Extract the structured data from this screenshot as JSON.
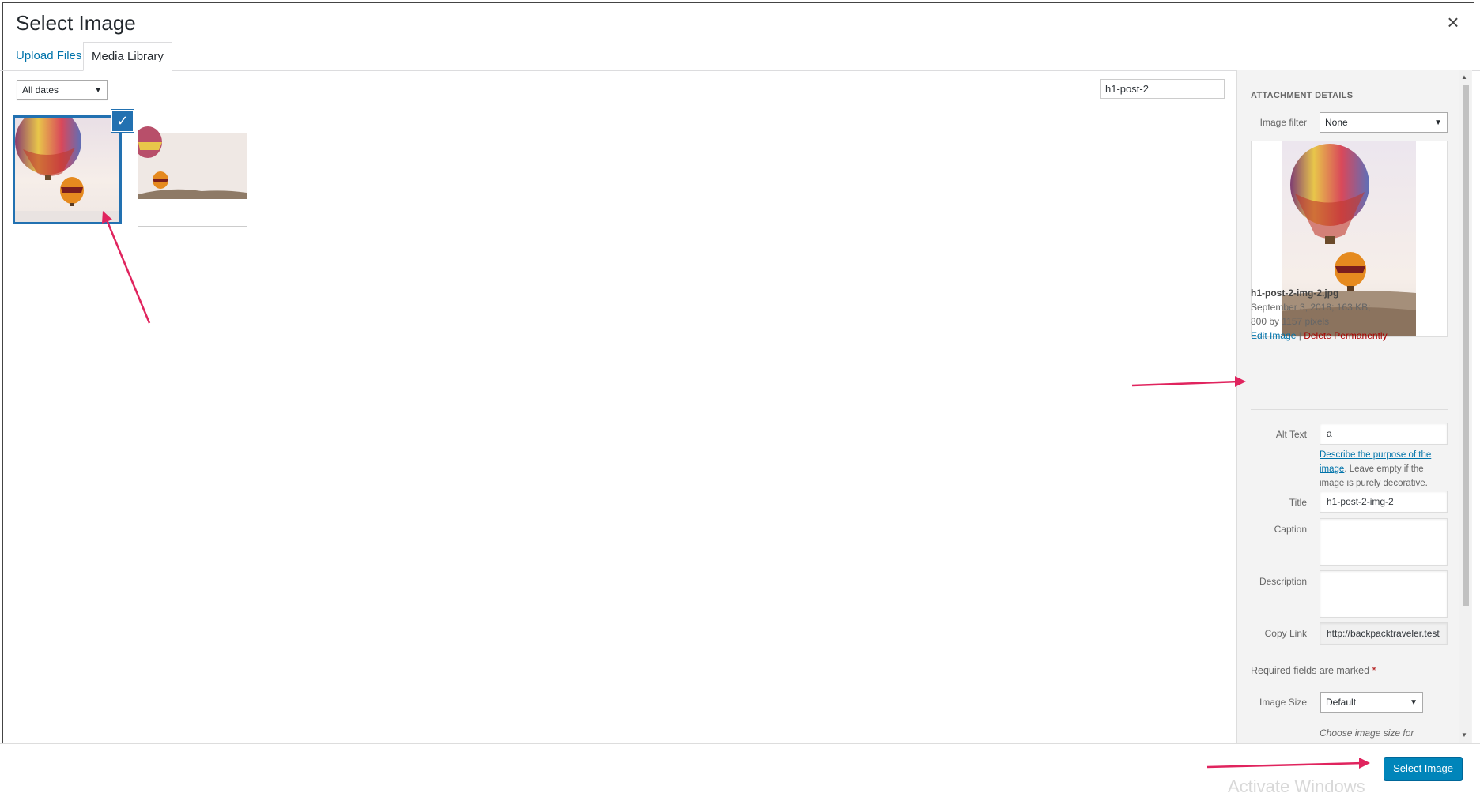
{
  "modal": {
    "title": "Select Image",
    "close_icon": "close-icon"
  },
  "tabs": [
    {
      "label": "Upload Files",
      "active": false
    },
    {
      "label": "Media Library",
      "active": true
    }
  ],
  "toolbar": {
    "date_filter": "All dates",
    "search_value": "h1-post-2"
  },
  "library": {
    "items": [
      {
        "selected": true,
        "check_icon": "checkmark-icon"
      },
      {
        "selected": false
      }
    ]
  },
  "details": {
    "heading": "ATTACHMENT DETAILS",
    "image_filter_label": "Image filter",
    "image_filter_value": "None",
    "filename": "h1-post-2-img-2.jpg",
    "date_size": "September 3, 2018;  163 KB;",
    "dimensions": "800 by 1157 pixels",
    "edit_link": "Edit Image",
    "separator": "|",
    "delete_link": "Delete Permanently",
    "alt_label": "Alt Text",
    "alt_value": "a",
    "alt_help_link": "Describe the purpose of the image",
    "alt_help_period": ".",
    "alt_help_rest": " Leave empty if the image is purely decorative.",
    "title_label": "Title",
    "title_value": "h1-post-2-img-2",
    "caption_label": "Caption",
    "caption_value": "",
    "description_label": "Description",
    "description_value": "",
    "copy_link_label": "Copy Link",
    "copy_link_value": "http://backpacktraveler.test",
    "required_text": "Required fields are marked",
    "required_star": "*",
    "image_size_label": "Image Size",
    "image_size_value": "Default",
    "image_size_help": "Choose image size for"
  },
  "footer": {
    "select_button": "Select Image"
  },
  "watermark": "Activate Windows",
  "colors": {
    "accent": "#2271b1",
    "button": "#0085ba",
    "delete": "#aa0000",
    "annotation_arrow": "#e0245e"
  }
}
